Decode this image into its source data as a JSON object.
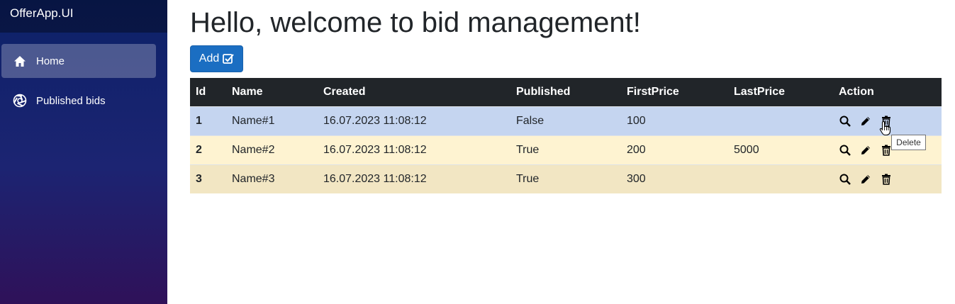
{
  "app": {
    "brand": "OfferApp.UI"
  },
  "sidebar": {
    "items": [
      {
        "label": "Home",
        "icon": "home-icon",
        "active": true
      },
      {
        "label": "Published bids",
        "icon": "aperture-icon",
        "active": false
      }
    ]
  },
  "main": {
    "title": "Hello, welcome to bid management!",
    "add_button": "Add"
  },
  "table": {
    "columns": [
      "Id",
      "Name",
      "Created",
      "Published",
      "FirstPrice",
      "LastPrice",
      "Action"
    ],
    "rows": [
      {
        "id": "1",
        "name": "Name#1",
        "created": "16.07.2023 11:08:12",
        "published": "False",
        "first_price": "100",
        "last_price": ""
      },
      {
        "id": "2",
        "name": "Name#2",
        "created": "16.07.2023 11:08:12",
        "published": "True",
        "first_price": "200",
        "last_price": "5000"
      },
      {
        "id": "3",
        "name": "Name#3",
        "created": "16.07.2023 11:08:12",
        "published": "True",
        "first_price": "300",
        "last_price": ""
      }
    ],
    "actions": [
      "search-icon",
      "edit-icon",
      "delete-icon"
    ]
  },
  "tooltip": {
    "text": "Delete"
  },
  "colors": {
    "accent": "#1b6ec2",
    "table_header": "#212529",
    "row_selected": "#c5d5f0",
    "row_alt_1": "#fef3d1",
    "row_alt_2": "#f2e6c3"
  }
}
